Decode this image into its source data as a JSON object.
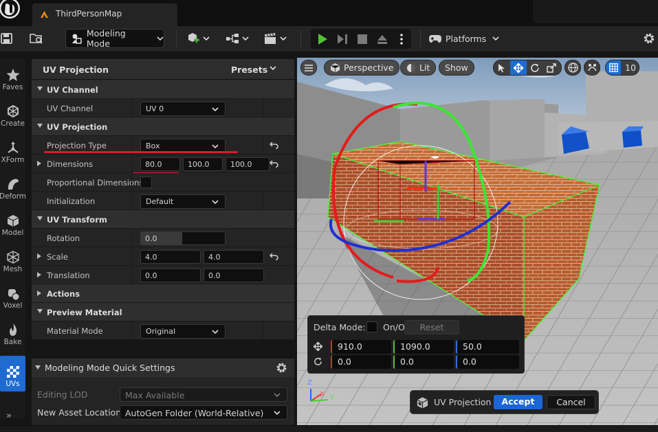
{
  "window": {
    "tab_title": "ThirdPersonMap"
  },
  "toolbar": {
    "mode_label": "Modeling Mode",
    "platforms_label": "Platforms"
  },
  "modes": [
    {
      "label": "Faves",
      "icon": "star-icon"
    },
    {
      "label": "Create",
      "icon": "create-icon"
    },
    {
      "label": "XForm",
      "icon": "xform-icon"
    },
    {
      "label": "Deform",
      "icon": "deform-icon"
    },
    {
      "label": "Model",
      "icon": "model-icon"
    },
    {
      "label": "Mesh",
      "icon": "mesh-icon"
    },
    {
      "label": "Voxel",
      "icon": "voxel-icon"
    },
    {
      "label": "Bake",
      "icon": "bake-icon"
    },
    {
      "label": "UVs",
      "icon": "uvs-icon",
      "active": true
    }
  ],
  "panel": {
    "title": "UV Projection",
    "presets_label": "Presets",
    "uv_channel": {
      "category": "UV Channel",
      "label": "UV Channel",
      "value": "UV 0"
    },
    "uv_projection": {
      "category": "UV Projection",
      "projection_type_label": "Projection Type",
      "projection_type_value": "Box",
      "dimensions_label": "Dimensions",
      "dimensions": [
        "80.0",
        "100.0",
        "100.0"
      ],
      "proportional_label": "Proportional Dimensions",
      "proportional_checked": false,
      "initialization_label": "Initialization",
      "initialization_value": "Default"
    },
    "uv_transform": {
      "category": "UV Transform",
      "rotation_label": "Rotation",
      "rotation_value": "0.0",
      "scale_label": "Scale",
      "scale": [
        "4.0",
        "4.0"
      ],
      "translation_label": "Translation",
      "translation": [
        "0.0",
        "0.0"
      ]
    },
    "actions": {
      "category": "Actions"
    },
    "preview_material": {
      "category": "Preview Material",
      "material_mode_label": "Material Mode",
      "material_mode_value": "Original"
    }
  },
  "quick_settings": {
    "title": "Modeling Mode Quick Settings",
    "editing_lod_label": "Editing LOD",
    "editing_lod_value": "Max Available",
    "new_asset_location_label": "New Asset Location",
    "new_asset_location_value": "AutoGen Folder (World-Relative)"
  },
  "viewport": {
    "perspective_label": "Perspective",
    "lit_label": "Lit",
    "show_label": "Show",
    "grid_snap_value": "10",
    "delta": {
      "mode_label": "Delta Mode:",
      "onoff_label": "On/Off",
      "reset_label": "Reset",
      "translate": [
        "910.0",
        "1090.0",
        "50.0"
      ],
      "rotate": [
        "0.0",
        "0.0",
        "0.0"
      ]
    },
    "tool": {
      "name": "UV Projection",
      "accept_label": "Accept",
      "cancel_label": "Cancel"
    },
    "axes": {
      "x": "X",
      "y": "Y",
      "z": "Z"
    }
  },
  "colors": {
    "accent": "#1f6bd1",
    "axis_x": "#d32f2f",
    "axis_y": "#5fbf2f",
    "axis_z": "#2f6fe0",
    "annotation": "#e0182a"
  }
}
